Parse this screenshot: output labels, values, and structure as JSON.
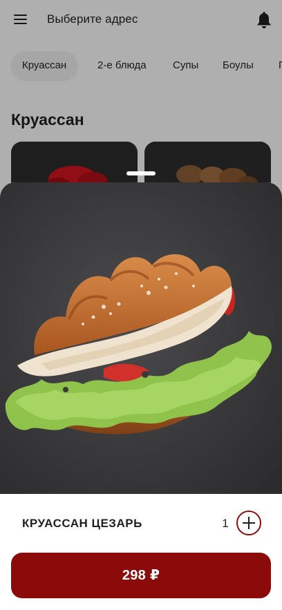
{
  "header": {
    "address_prompt": "Выберите адрес"
  },
  "tabs": [
    {
      "label": "Круассан",
      "active": true
    },
    {
      "label": "2-е блюда",
      "active": false
    },
    {
      "label": "Супы",
      "active": false
    },
    {
      "label": "Боулы",
      "active": false
    },
    {
      "label": "П",
      "active": false
    }
  ],
  "section": {
    "title": "Круассан"
  },
  "product": {
    "name": "КРУАССАН ЦЕЗАРЬ",
    "quantity": "1",
    "price_label": "298 ₽"
  },
  "colors": {
    "accent": "#8b0a0a",
    "background": "#f3f3f3",
    "text": "#1f1f1f"
  },
  "icons": {
    "menu": "hamburger-menu",
    "notifications": "bell",
    "add": "plus-in-circle"
  }
}
